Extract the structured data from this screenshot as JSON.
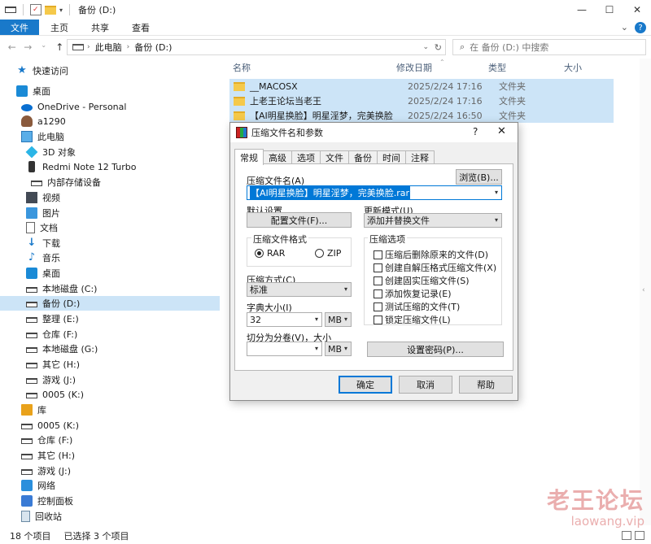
{
  "window": {
    "title": "备份 (D:)",
    "controls": [
      "—",
      "☐",
      "✕"
    ]
  },
  "ribbon": {
    "tabs": [
      "文件",
      "主页",
      "共享",
      "查看"
    ],
    "help": "?"
  },
  "address": {
    "crumbs": [
      "此电脑",
      "备份 (D:)"
    ],
    "search_placeholder": "在 备份 (D:) 中搜索"
  },
  "sidebar": {
    "items": [
      {
        "label": "快速访问",
        "icon": "star-icon"
      },
      {
        "label": "桌面",
        "icon": "desktop-icon"
      },
      {
        "label": "OneDrive - Personal",
        "icon": "cloud-icon"
      },
      {
        "label": "a1290",
        "icon": "user-icon"
      },
      {
        "label": "此电脑",
        "icon": "pc-icon"
      },
      {
        "label": "3D 对象",
        "icon": "cube-icon"
      },
      {
        "label": "Redmi Note 12 Turbo",
        "icon": "phone-icon"
      },
      {
        "label": "内部存储设备",
        "icon": "drive-icon"
      },
      {
        "label": "视频",
        "icon": "video-icon"
      },
      {
        "label": "图片",
        "icon": "picture-icon"
      },
      {
        "label": "文档",
        "icon": "document-icon"
      },
      {
        "label": "下载",
        "icon": "download-icon"
      },
      {
        "label": "音乐",
        "icon": "music-icon"
      },
      {
        "label": "桌面",
        "icon": "desktop-icon"
      },
      {
        "label": "本地磁盘 (C:)",
        "icon": "drive-icon"
      },
      {
        "label": "备份 (D:)",
        "icon": "drive-icon"
      },
      {
        "label": "整理 (E:)",
        "icon": "drive-icon"
      },
      {
        "label": "仓库 (F:)",
        "icon": "drive-icon"
      },
      {
        "label": "本地磁盘 (G:)",
        "icon": "drive-icon"
      },
      {
        "label": "其它 (H:)",
        "icon": "drive-icon"
      },
      {
        "label": "游戏 (J:)",
        "icon": "drive-icon"
      },
      {
        "label": "0005 (K:)",
        "icon": "drive-icon"
      },
      {
        "label": "库",
        "icon": "library-icon"
      },
      {
        "label": "0005 (K:)",
        "icon": "drive-icon"
      },
      {
        "label": "仓库 (F:)",
        "icon": "drive-icon"
      },
      {
        "label": "其它 (H:)",
        "icon": "drive-icon"
      },
      {
        "label": "游戏 (J:)",
        "icon": "drive-icon"
      },
      {
        "label": "网络",
        "icon": "network-icon"
      },
      {
        "label": "控制面板",
        "icon": "control-panel-icon"
      },
      {
        "label": "回收站",
        "icon": "recycle-bin-icon"
      }
    ],
    "selected_label": "备份 (D:)"
  },
  "filelist": {
    "columns": [
      "名称",
      "修改日期",
      "类型",
      "大小"
    ],
    "rows": [
      {
        "name": "__MACOSX",
        "date": "2025/2/24 17:16",
        "type": "文件夹"
      },
      {
        "name": "上老王论坛当老王",
        "date": "2025/2/24 17:16",
        "type": "文件夹"
      },
      {
        "name": "【AI明星换脸】明星淫梦，完美换脸",
        "date": "2025/2/24 16:50",
        "type": "文件夹"
      }
    ]
  },
  "status": {
    "count": "18 个项目",
    "selected": "已选择 3 个项目"
  },
  "watermark": {
    "line1": "老王论坛",
    "line2": "laowang.vip"
  },
  "dialog": {
    "title": "压缩文件名和参数",
    "help": "?",
    "close": "✕",
    "tabs": [
      "常规",
      "高级",
      "选项",
      "文件",
      "备份",
      "时间",
      "注释"
    ],
    "archive_name_label": "压缩文件名(A)",
    "browse_button": "浏览(B)...",
    "archive_name_value": "【AI明星换脸】明星淫梦，完美换脸.rar",
    "default_settings_label": "默认设置",
    "profiles_button": "配置文件(F)...",
    "update_mode_label": "更新模式(U)",
    "update_mode_value": "添加并替换文件",
    "format_group": "压缩文件格式",
    "format_rar": "RAR",
    "format_zip": "ZIP",
    "method_label": "压缩方式(C)",
    "method_value": "标准",
    "dict_label": "字典大小(I)",
    "dict_value": "32",
    "dict_unit": "MB",
    "split_label": "切分为分卷(V)，大小",
    "split_value": "",
    "split_unit": "MB",
    "options_group": "压缩选项",
    "options": [
      "压缩后删除原来的文件(D)",
      "创建自解压格式压缩文件(X)",
      "创建固实压缩文件(S)",
      "添加恢复记录(E)",
      "测试压缩的文件(T)",
      "锁定压缩文件(L)"
    ],
    "password_button": "设置密码(P)...",
    "ok_button": "确定",
    "cancel_button": "取消",
    "help_button": "帮助"
  }
}
